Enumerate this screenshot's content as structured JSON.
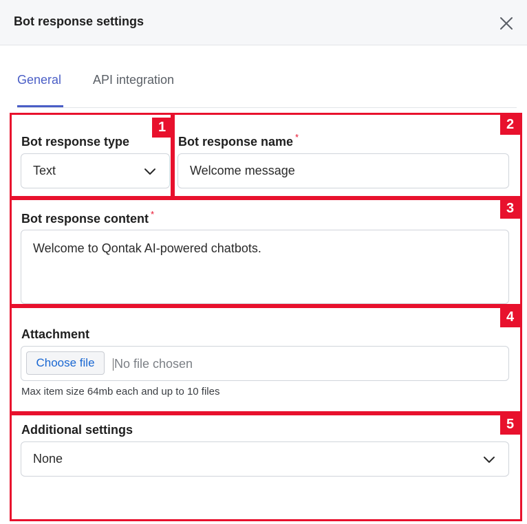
{
  "dialog": {
    "title": "Bot response settings",
    "close_icon": "close-icon"
  },
  "tabs": [
    {
      "label": "General",
      "active": true
    },
    {
      "label": "API integration",
      "active": false
    }
  ],
  "markers": [
    "1",
    "2",
    "3",
    "4",
    "5"
  ],
  "form": {
    "response_type": {
      "label": "Bot response type",
      "value": "Text"
    },
    "response_name": {
      "label": "Bot response name",
      "required_mark": "*",
      "value": "Welcome message"
    },
    "response_content": {
      "label": "Bot response content",
      "required_mark": "*",
      "value": "Welcome to Qontak AI-powered chatbots."
    },
    "attachment": {
      "label": "Attachment",
      "button_label": "Choose file",
      "status": "No file chosen",
      "helper": "Max item size 64mb each and up to 10 files"
    },
    "additional_settings": {
      "label": "Additional settings",
      "value": "None"
    }
  },
  "colors": {
    "accent": "#4a5ec6",
    "highlight": "#e8112d",
    "file_button_text": "#1967d2"
  }
}
